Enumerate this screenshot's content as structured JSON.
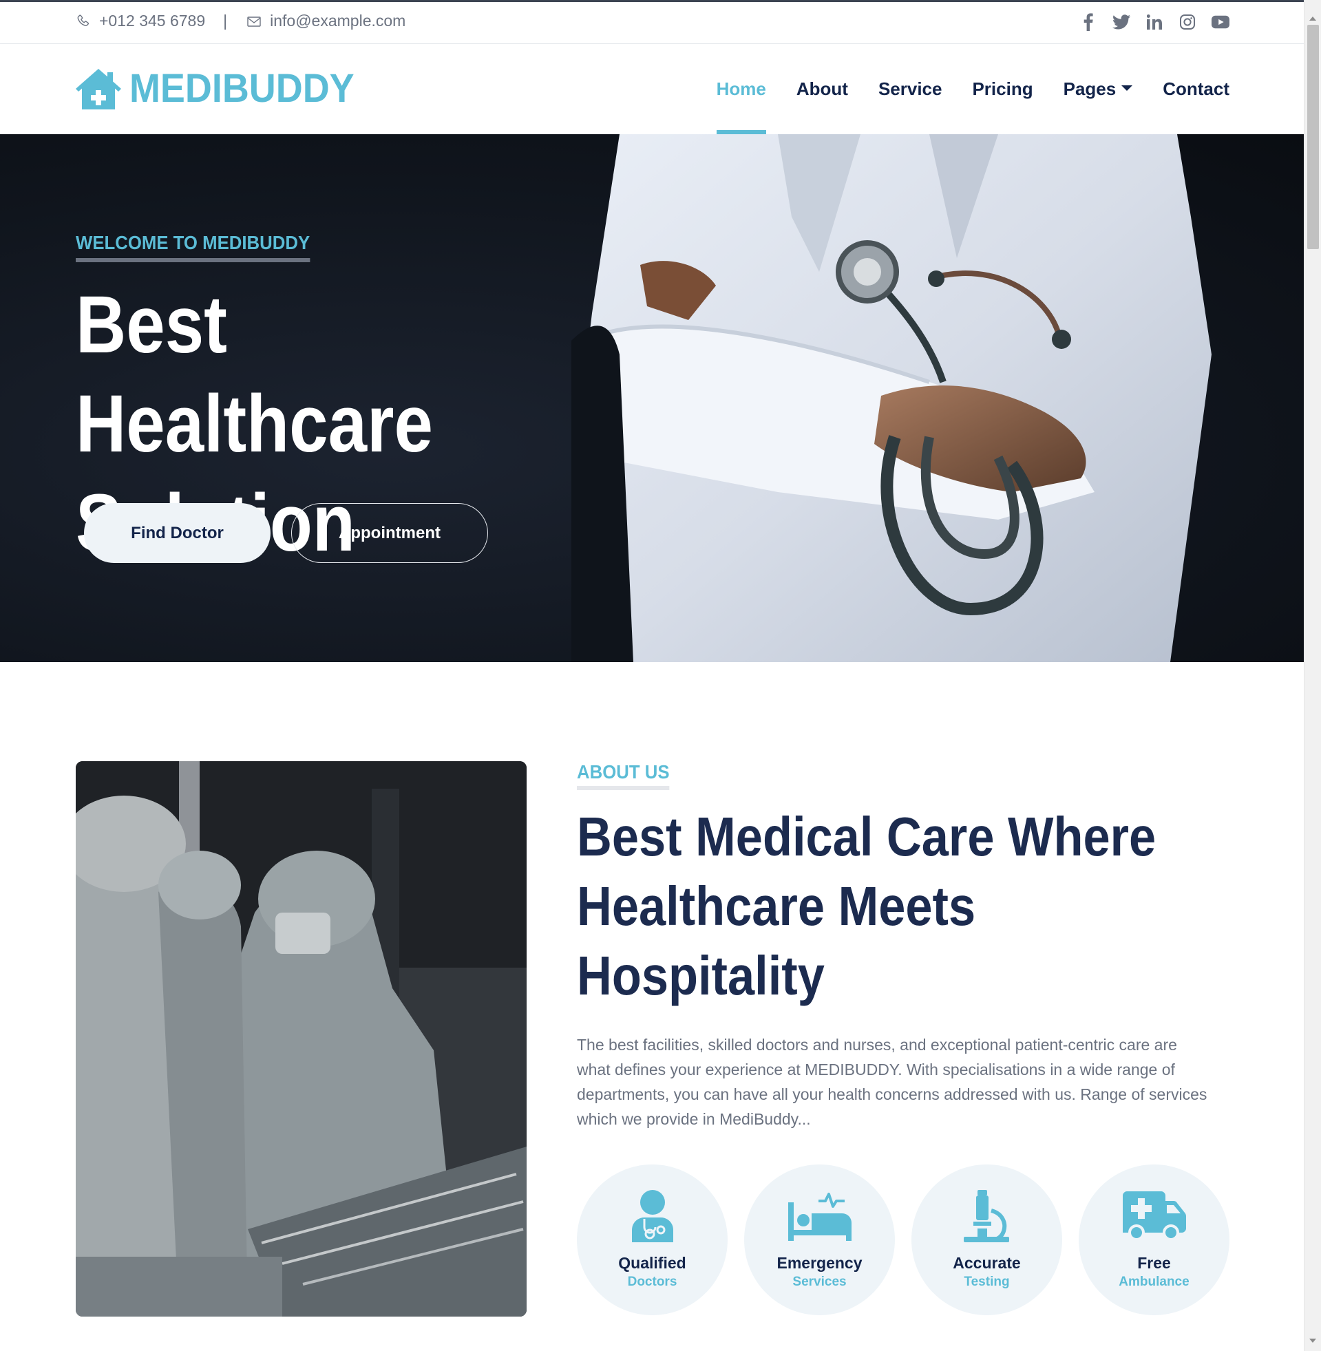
{
  "topbar": {
    "phone": "+012 345 6789",
    "separator": "|",
    "email": "info@example.com",
    "social_icons": [
      "facebook-icon",
      "twitter-icon",
      "linkedin-icon",
      "instagram-icon",
      "youtube-icon"
    ]
  },
  "navbar": {
    "brand": "MEDIBUDDY",
    "items": [
      {
        "label": "Home",
        "active": true
      },
      {
        "label": "About"
      },
      {
        "label": "Service"
      },
      {
        "label": "Pricing"
      },
      {
        "label": "Pages",
        "dropdown": true
      },
      {
        "label": "Contact"
      }
    ]
  },
  "hero": {
    "eyebrow": "WELCOME TO MEDIBUDDY",
    "title_line1": "Best Healthcare",
    "title_line2": "Solution",
    "primary_button": "Find Doctor",
    "secondary_button": "Appointment"
  },
  "about": {
    "eyebrow": "ABOUT US",
    "title_line1": "Best Medical Care Where",
    "title_line2": "Healthcare Meets",
    "title_line3": "Hospitality",
    "text": "The best facilities, skilled doctors and nurses, and exceptional patient-centric care are what defines your experience at MEDIBUDDY. With specialisations in a wide range of departments, you can have all your health concerns addressed with us. Range of services which we provide in MediBuddy...",
    "features": [
      {
        "title": "Qualified",
        "subtitle": "Doctors",
        "icon": "doctor-icon"
      },
      {
        "title": "Emergency",
        "subtitle": "Services",
        "icon": "hospital-bed-icon"
      },
      {
        "title": "Accurate",
        "subtitle": "Testing",
        "icon": "microscope-icon"
      },
      {
        "title": "Free",
        "subtitle": "Ambulance",
        "icon": "ambulance-icon"
      }
    ]
  },
  "colors": {
    "accent": "#5bbcd6",
    "navy": "#13244a",
    "muted": "#6b7280",
    "hero_bg": "#10151d"
  }
}
